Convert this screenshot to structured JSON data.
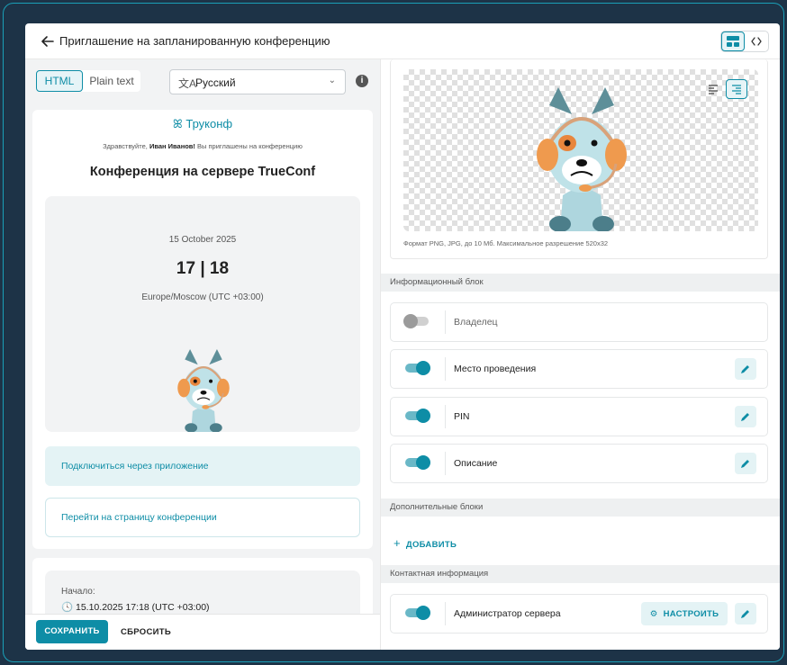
{
  "header": {
    "title": "Приглашение на запланированную конференцию"
  },
  "editor": {
    "format_tabs": [
      "HTML",
      "Plain text"
    ],
    "language": "Русский"
  },
  "preview": {
    "brand": "Труконф",
    "greeting_prefix": "Здравствуйте, ",
    "greeting_name": "Иван Иванов!",
    "greeting_suffix": " Вы приглашены на конференцию",
    "conference_title": "Конференция на сервере TrueConf",
    "date": "15 October 2025",
    "time": "17 | 18",
    "timezone": "Europe/Moscow (UTC +03:00)",
    "join_app_label": "Подключиться через приложение",
    "join_page_label": "Перейти на страницу конференции",
    "start_label": "Начало:",
    "start_value": "15.10.2025 17:18 (UTC +03:00)"
  },
  "footer": {
    "save_label": "СОХРАНИТЬ",
    "reset_label": "СБРОСИТЬ"
  },
  "logo": {
    "format_hint": "Формат PNG, JPG, до 10 Мб. Максимальное разрешение 520x32"
  },
  "info_block": {
    "title": "Информационный блок",
    "items": [
      {
        "label": "Владелец",
        "enabled": false
      },
      {
        "label": "Место проведения",
        "enabled": true
      },
      {
        "label": "PIN",
        "enabled": true
      },
      {
        "label": "Описание",
        "enabled": true
      }
    ]
  },
  "extra_blocks": {
    "title": "Дополнительные блоки",
    "add_label": "ДОБАВИТЬ"
  },
  "contact_info": {
    "title": "Контактная информация",
    "item_label": "Администратор сервера",
    "configure_label": "НАСТРОИТЬ"
  },
  "colors": {
    "accent": "#0e8da6",
    "background": "#1d3347"
  }
}
